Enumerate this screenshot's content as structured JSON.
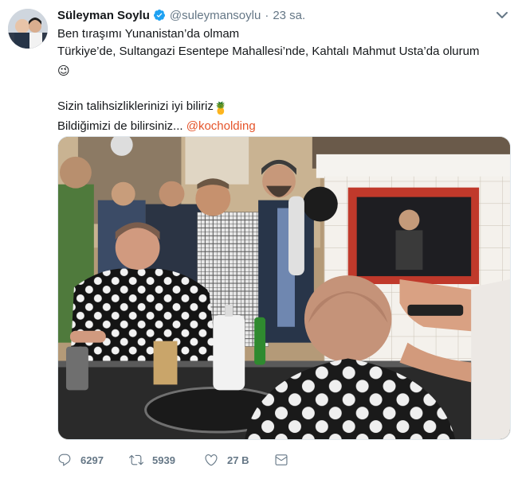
{
  "author": {
    "name": "Süleyman Soylu",
    "handle": "@suleymansoylu",
    "separator": "·",
    "time": "23 sa."
  },
  "tweet": {
    "line1": "Ben tıraşımı Yunanistan’da olmam",
    "line2": "Türkiye’de, Sultangazi Esentepe Mahallesi’nde, Kahtalı Mahmut Usta’da olurum",
    "line3_emoji": "😉",
    "line4": "Sizin talihsizliklerinizi iyi biliriz",
    "line4_emoji": "🍍",
    "line5_prefix": "Bildiğimizi de bilirsiniz...",
    "line5_mention": "@kocholding"
  },
  "actions": {
    "reply_count": "6297",
    "retweet_count": "5939",
    "like_count": "27 B"
  },
  "icons": {
    "verified": "verified-badge-icon",
    "caret": "chevron-down-icon",
    "reply": "reply-icon",
    "retweet": "retweet-icon",
    "like": "heart-icon",
    "dm": "envelope-icon"
  },
  "colors": {
    "name": "#14171a",
    "muted": "#657786",
    "verified": "#1da1f2",
    "mention": "#e5542a"
  }
}
